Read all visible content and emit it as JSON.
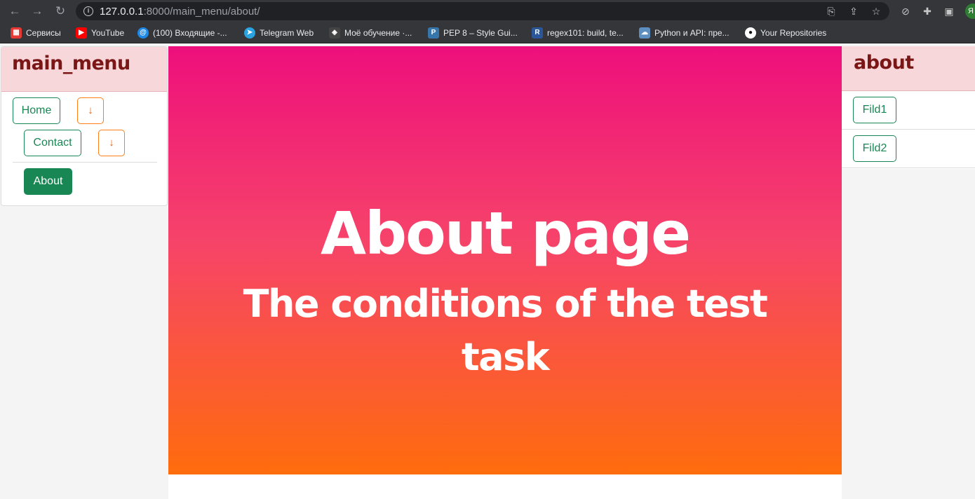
{
  "browser": {
    "url_host": "127.0.0.1",
    "url_rest": ":8000/main_menu/about/",
    "profile_initial": "Я",
    "bookmarks": [
      {
        "label": "Сервисы",
        "color": "#e53935"
      },
      {
        "label": "YouTube",
        "color": "#ff0000"
      },
      {
        "label": "(100) Входящие -...",
        "color": "#1e88e5"
      },
      {
        "label": "Telegram Web",
        "color": "#2aa3e0"
      },
      {
        "label": "Моё обучение ·...",
        "color": "#444444"
      },
      {
        "label": "PEP 8 – Style Gui...",
        "color": "#3776ab"
      },
      {
        "label": "regex101: build, te...",
        "color": "#2b579a"
      },
      {
        "label": "Python и API: пре...",
        "color": "#5c8fbf"
      },
      {
        "label": "Your Repositories",
        "color": "#ffffff"
      }
    ]
  },
  "left_menu": {
    "title": "main_menu",
    "home_label": "Home",
    "contact_label": "Contact",
    "about_label": "About",
    "arrow_glyph": "↓"
  },
  "hero": {
    "title": "About page",
    "subtitle": "The conditions of the test task"
  },
  "right_menu": {
    "title": "about",
    "items": [
      "Fild1",
      "Fild2"
    ]
  },
  "colors": {
    "accent_green": "#198754",
    "accent_orange": "#fd7e14",
    "header_pink": "#f8d7da",
    "title_maroon": "#7a1616"
  }
}
